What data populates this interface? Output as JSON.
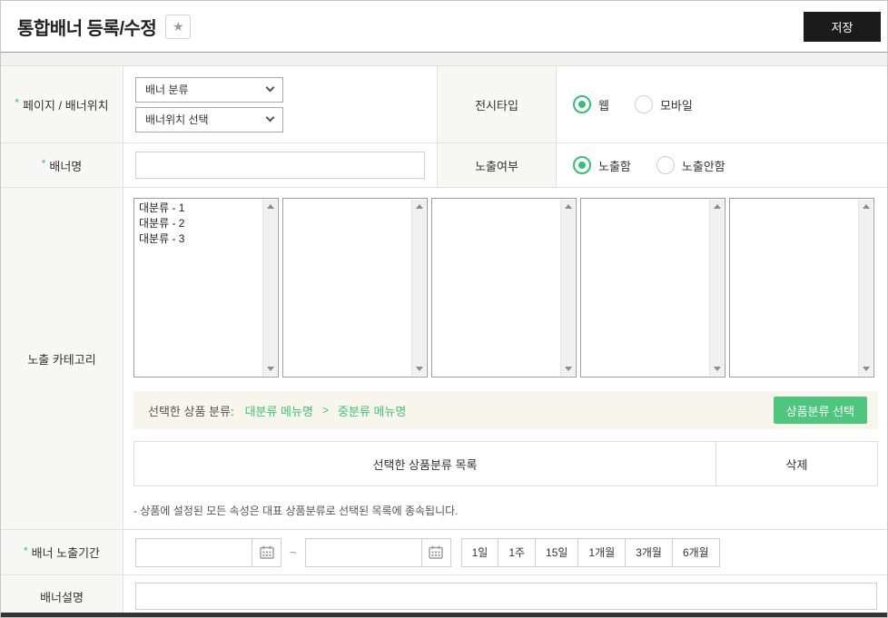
{
  "header": {
    "title": "통합배너 등록/수정",
    "star_icon": "★",
    "save_label": "저장"
  },
  "form": {
    "page_position": {
      "required_mark": "*",
      "label": "페이지 / 배너위치",
      "banner_class_select": "배너 분류",
      "banner_position_select": "배너위치 선택"
    },
    "display_type": {
      "label": "전시타입",
      "option_web": "웹",
      "option_mobile": "모바일",
      "selected": "웹"
    },
    "banner_name": {
      "required_mark": "*",
      "label": "배너명"
    },
    "visibility": {
      "label": "노출여부",
      "option_show": "노출함",
      "option_hide": "노출안함",
      "selected": "노출함"
    },
    "category": {
      "label": "노출 카테고리",
      "listbox1_items": [
        "대분류 - 1",
        "대분류 - 2",
        "대분류 - 3"
      ],
      "selected_label": "선택한 상품 분류:",
      "selected_depth1": "대분류 메뉴명",
      "path_separator": ">",
      "selected_depth2": "중분류 메뉴명",
      "pick_button": "상품분류 선택",
      "table_col_list": "선택한 상품분류 목록",
      "table_col_delete": "삭제",
      "note": "- 상품에 설정된 모든 속성은 대표 상품분류로 선택된 목록에 종속됩니다."
    },
    "period": {
      "required_mark": "*",
      "label": "배너 노출기간",
      "separator": "~",
      "buttons": [
        "1일",
        "1주",
        "15일",
        "1개월",
        "3개월",
        "6개월"
      ]
    },
    "description": {
      "label": "배너설명"
    }
  },
  "colors": {
    "accent_green": "#35bf77",
    "button_green": "#4dc67e",
    "save_button_black": "#1b1b1b"
  }
}
